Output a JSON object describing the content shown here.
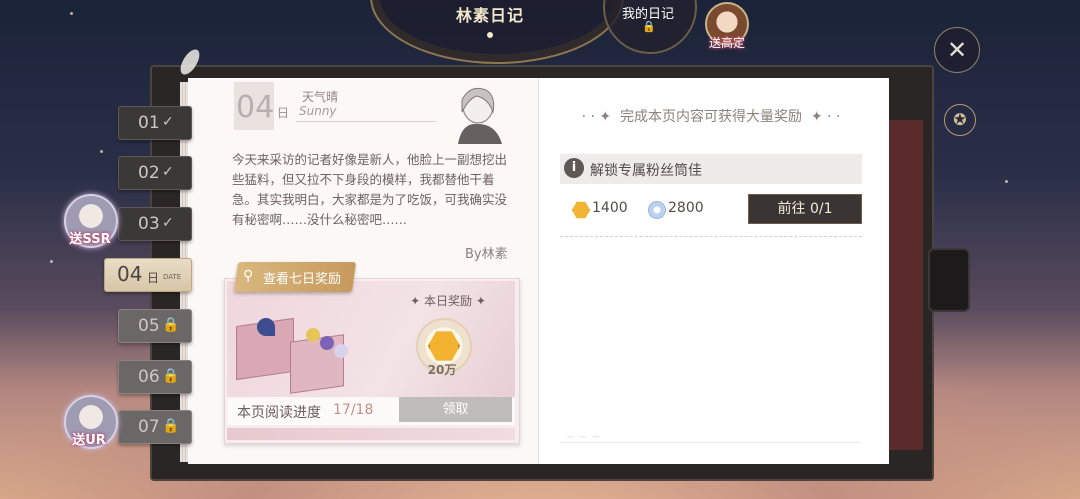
{
  "header": {
    "tab_main": "林素日记",
    "tab_my": "我的日记",
    "gift_label": "送高定"
  },
  "chapters": [
    {
      "num": "01",
      "mark": "✓",
      "state": "done"
    },
    {
      "num": "02",
      "mark": "✓",
      "state": "done"
    },
    {
      "num": "03",
      "mark": "✓",
      "state": "done"
    },
    {
      "num": "04",
      "mark": "日",
      "sub": "DATE",
      "state": "active"
    },
    {
      "num": "05",
      "mark": "🔒",
      "state": "locked"
    },
    {
      "num": "06",
      "mark": "🔒",
      "state": "locked"
    },
    {
      "num": "07",
      "mark": "🔒",
      "state": "locked"
    }
  ],
  "side_rewards": {
    "ssr": "送SSR",
    "ur": "送UR"
  },
  "diary": {
    "date": "04",
    "date_unit": "日",
    "weather_cn": "天气晴",
    "weather_en": "Sunny",
    "text": "今天来采访的记者好像是新人，他脸上一副想挖出些猛料，但又拉不下身段的模样，我都替他干着急。其实我明白，大家都是为了吃饭，可我确实没有秘密啊……没什么秘密吧……",
    "author": "By林素"
  },
  "reward_card": {
    "seven_day_label": "查看七日奖励",
    "today_label": "本日奖励",
    "coin_amount": "20万",
    "progress_label": "本页阅读进度",
    "progress_value": "17/18",
    "progress_fraction": 0.944,
    "claim_label": "领取"
  },
  "task": {
    "title": "完成本页内容可获得大量奖励",
    "item_text": "解锁专属粉丝筒佳",
    "info_icon": "i",
    "gold": "1400",
    "diamond": "2800",
    "go_label": "前往 0/1"
  },
  "colors": {
    "accent_gold": "#d8b77e",
    "progress_pink": "#c78d86",
    "button_dark": "#3a3534"
  }
}
